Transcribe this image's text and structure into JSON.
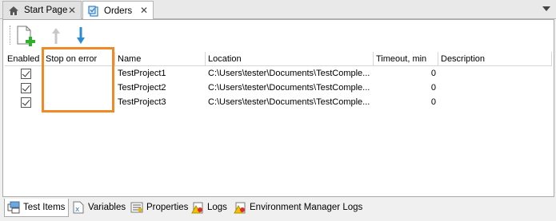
{
  "doc_tabs": [
    {
      "label": "Start Page",
      "icon": "home-icon",
      "close": "✕"
    },
    {
      "label": "Orders",
      "icon": "orders-icon",
      "close": "✕"
    }
  ],
  "toolbar": {
    "buttons": [
      {
        "name": "add-item-button",
        "icon": "new-item-icon"
      },
      {
        "name": "move-up-button",
        "icon": "arrow-up-icon"
      },
      {
        "name": "move-down-button",
        "icon": "arrow-down-icon"
      }
    ]
  },
  "table": {
    "columns": [
      "Enabled",
      "Stop on error",
      "Name",
      "Location",
      "Timeout, min",
      "Description"
    ],
    "rows": [
      {
        "enabled": true,
        "stop_on_error": true,
        "name": "TestProject1",
        "location": "C:\\Users\\tester\\Documents\\TestComple...",
        "timeout": "0",
        "description": ""
      },
      {
        "enabled": true,
        "stop_on_error": true,
        "name": "TestProject2",
        "location": "C:\\Users\\tester\\Documents\\TestComple...",
        "timeout": "0",
        "description": ""
      },
      {
        "enabled": true,
        "stop_on_error": false,
        "name": "TestProject3",
        "location": "C:\\Users\\tester\\Documents\\TestComple...",
        "timeout": "0",
        "description": ""
      }
    ]
  },
  "highlight_color": "#f08a24",
  "bottom_tabs": [
    {
      "label": "Test Items",
      "icon": "test-items-icon"
    },
    {
      "label": "Variables",
      "icon": "variables-icon"
    },
    {
      "label": "Properties",
      "icon": "properties-icon"
    },
    {
      "label": "Logs",
      "icon": "logs-icon"
    },
    {
      "label": "Environment Manager Logs",
      "icon": "env-logs-icon"
    }
  ]
}
